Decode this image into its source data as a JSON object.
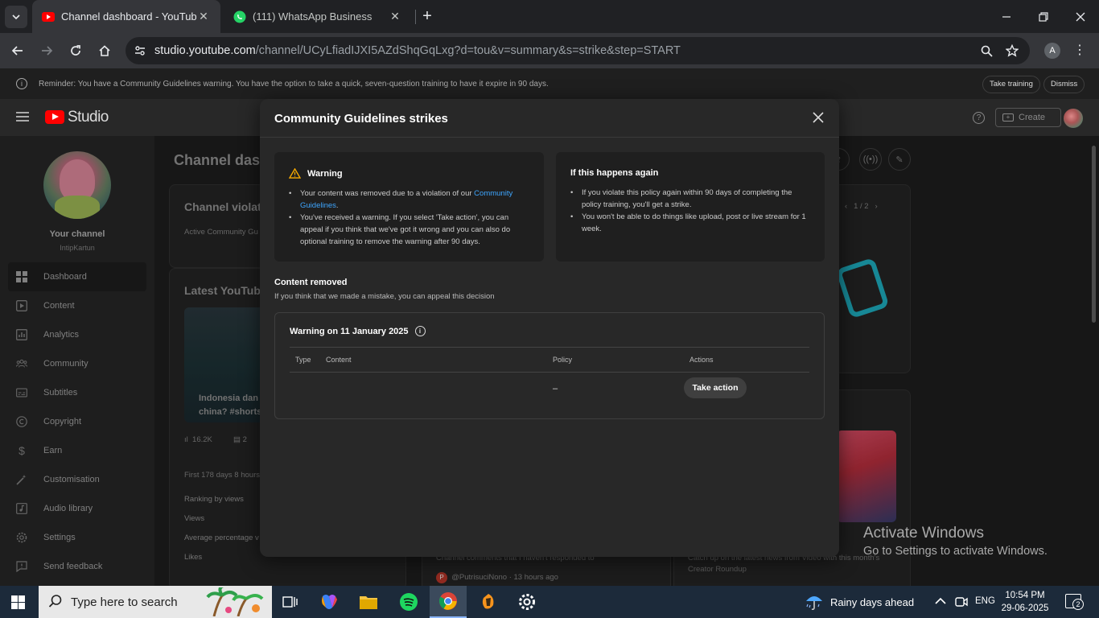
{
  "browser": {
    "tabs": [
      {
        "label": "Channel dashboard - YouTube Studio",
        "active": true
      },
      {
        "label": "(111) WhatsApp Business",
        "active": false
      }
    ],
    "url_host": "studio.youtube.com",
    "url_path": "/channel/UCyLfiadIJXI5AZdShqGqLxg?d=tou&v=summary&s=strike&step=START",
    "profile_initial": "A"
  },
  "reminder": {
    "text": "Reminder: You have a Community Guidelines warning. You have the option to take a quick, seven-question training to have it expire in 90 days.",
    "take_training": "Take training",
    "dismiss": "Dismiss"
  },
  "header": {
    "logo_text": "Studio",
    "create_label": "Create"
  },
  "sidebar": {
    "your_channel": "Your channel",
    "handle": "IntipKartun",
    "items": [
      {
        "label": "Dashboard",
        "icon": "dashboard-icon"
      },
      {
        "label": "Content",
        "icon": "content-icon"
      },
      {
        "label": "Analytics",
        "icon": "analytics-icon"
      },
      {
        "label": "Community",
        "icon": "community-icon"
      },
      {
        "label": "Subtitles",
        "icon": "subtitles-icon"
      },
      {
        "label": "Copyright",
        "icon": "copyright-icon"
      },
      {
        "label": "Earn",
        "icon": "earn-icon"
      },
      {
        "label": "Customisation",
        "icon": "customisation-icon"
      },
      {
        "label": "Audio library",
        "icon": "audio-library-icon"
      },
      {
        "label": "Settings",
        "icon": "settings-icon"
      },
      {
        "label": "Send feedback",
        "icon": "feedback-icon"
      }
    ]
  },
  "dashboard": {
    "title": "Channel dash",
    "violations_title": "Channel violatio",
    "violations_sub": "Active Community Gu",
    "latest_title": "Latest YouTube",
    "thumb_caption_1": "Indonesia dan l",
    "thumb_caption_2": "china? #shorts",
    "views": "16.2K",
    "comments": "2",
    "first_days": "First 178 days 8 hours",
    "ranking": "Ranking by views",
    "views_label": "Views",
    "avg_pct": "Average percentage v",
    "likes": "Likes",
    "pager": "1 / 2",
    "comments_note": "Channel comments that I haven't responded to",
    "commenter": "@PutrisuciNono · 13 hours ago",
    "news_note": "Catch up on the latest news from Video with this month's",
    "creator_roundup": "Creator Roundup"
  },
  "modal": {
    "title": "Community Guidelines strikes",
    "warning": {
      "heading": "Warning",
      "bullet1_pre": "Your content was removed due to a violation of our ",
      "bullet1_link": "Community Guidelines",
      "bullet1_post": ".",
      "bullet2": "You've received a warning. If you select 'Take action', you can appeal if you think that we've got it wrong and you can also do optional training to remove the warning after 90 days."
    },
    "again": {
      "heading": "If this happens again",
      "bullet1": "If you violate this policy again within 90 days of completing the policy training, you'll get a strike.",
      "bullet2": "You won't be able to do things like upload, post or live stream for 1 week."
    },
    "content_removed": {
      "title": "Content removed",
      "subtitle": "If you think that we made a mistake, you can appeal this decision"
    },
    "strike": {
      "date_label": "Warning on 11 January 2025",
      "columns": [
        "Type",
        "Content",
        "Policy",
        "Actions"
      ],
      "policy_value": "–",
      "action_label": "Take action"
    }
  },
  "watermark": {
    "title": "Activate Windows",
    "subtitle": "Go to Settings to activate Windows."
  },
  "taskbar": {
    "search_placeholder": "Type here to search",
    "weather": "Rainy days ahead",
    "lang": "ENG",
    "time": "10:54 PM",
    "date": "29-06-2025",
    "notifications": "2"
  },
  "colors": {
    "accent_link": "#3ea6ff",
    "yt_red": "#ff0000",
    "warning_yellow": "#f9ab00"
  }
}
